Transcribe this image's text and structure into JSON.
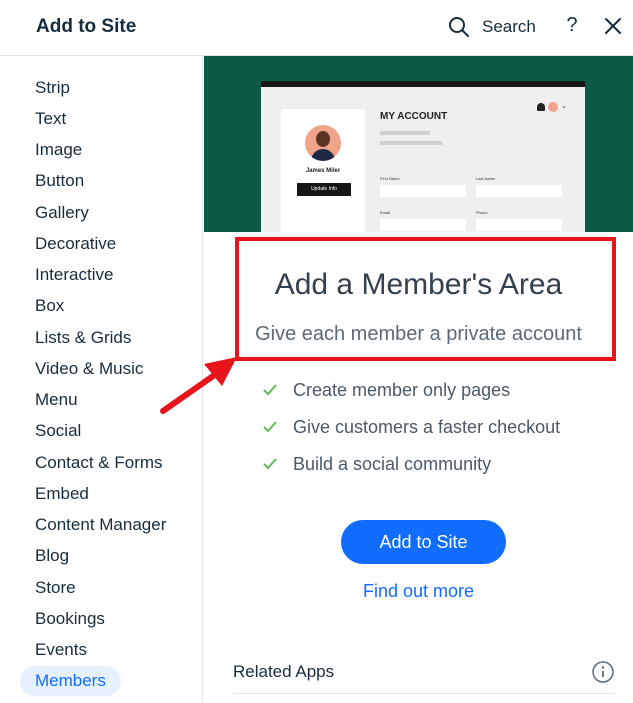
{
  "header": {
    "title": "Add to Site",
    "search_label": "Search",
    "help_label": "?",
    "close_icon": "close-icon"
  },
  "sidebar": {
    "items": [
      {
        "label": "Strip"
      },
      {
        "label": "Text"
      },
      {
        "label": "Image"
      },
      {
        "label": "Button"
      },
      {
        "label": "Gallery"
      },
      {
        "label": "Decorative"
      },
      {
        "label": "Interactive"
      },
      {
        "label": "Box"
      },
      {
        "label": "Lists & Grids"
      },
      {
        "label": "Video & Music"
      },
      {
        "label": "Menu"
      },
      {
        "label": "Social"
      },
      {
        "label": "Contact & Forms"
      },
      {
        "label": "Embed"
      },
      {
        "label": "Content Manager"
      },
      {
        "label": "Blog"
      },
      {
        "label": "Store"
      },
      {
        "label": "Bookings"
      },
      {
        "label": "Events"
      },
      {
        "label": "Members"
      }
    ],
    "selected": "Members"
  },
  "preview": {
    "page_title": "MY ACCOUNT",
    "member_name": "James Miler",
    "update_button": "Update Info",
    "fields": {
      "first_name": "First Name",
      "last_name": "Last Name",
      "email": "Email",
      "phone": "Phone"
    }
  },
  "main": {
    "headline": "Add a Member's Area",
    "subline": "Give each member a private account",
    "features": [
      {
        "label": "Create member only pages"
      },
      {
        "label": "Give customers a faster checkout"
      },
      {
        "label": "Build a social community"
      }
    ],
    "add_button": "Add to Site",
    "find_link": "Find out more",
    "related_label": "Related Apps"
  },
  "colors": {
    "accent": "#116dff",
    "selected_bg": "#e7f0ff",
    "preview_bg": "#0b5a43",
    "highlight": "#e8141b",
    "check": "#60bc57"
  }
}
